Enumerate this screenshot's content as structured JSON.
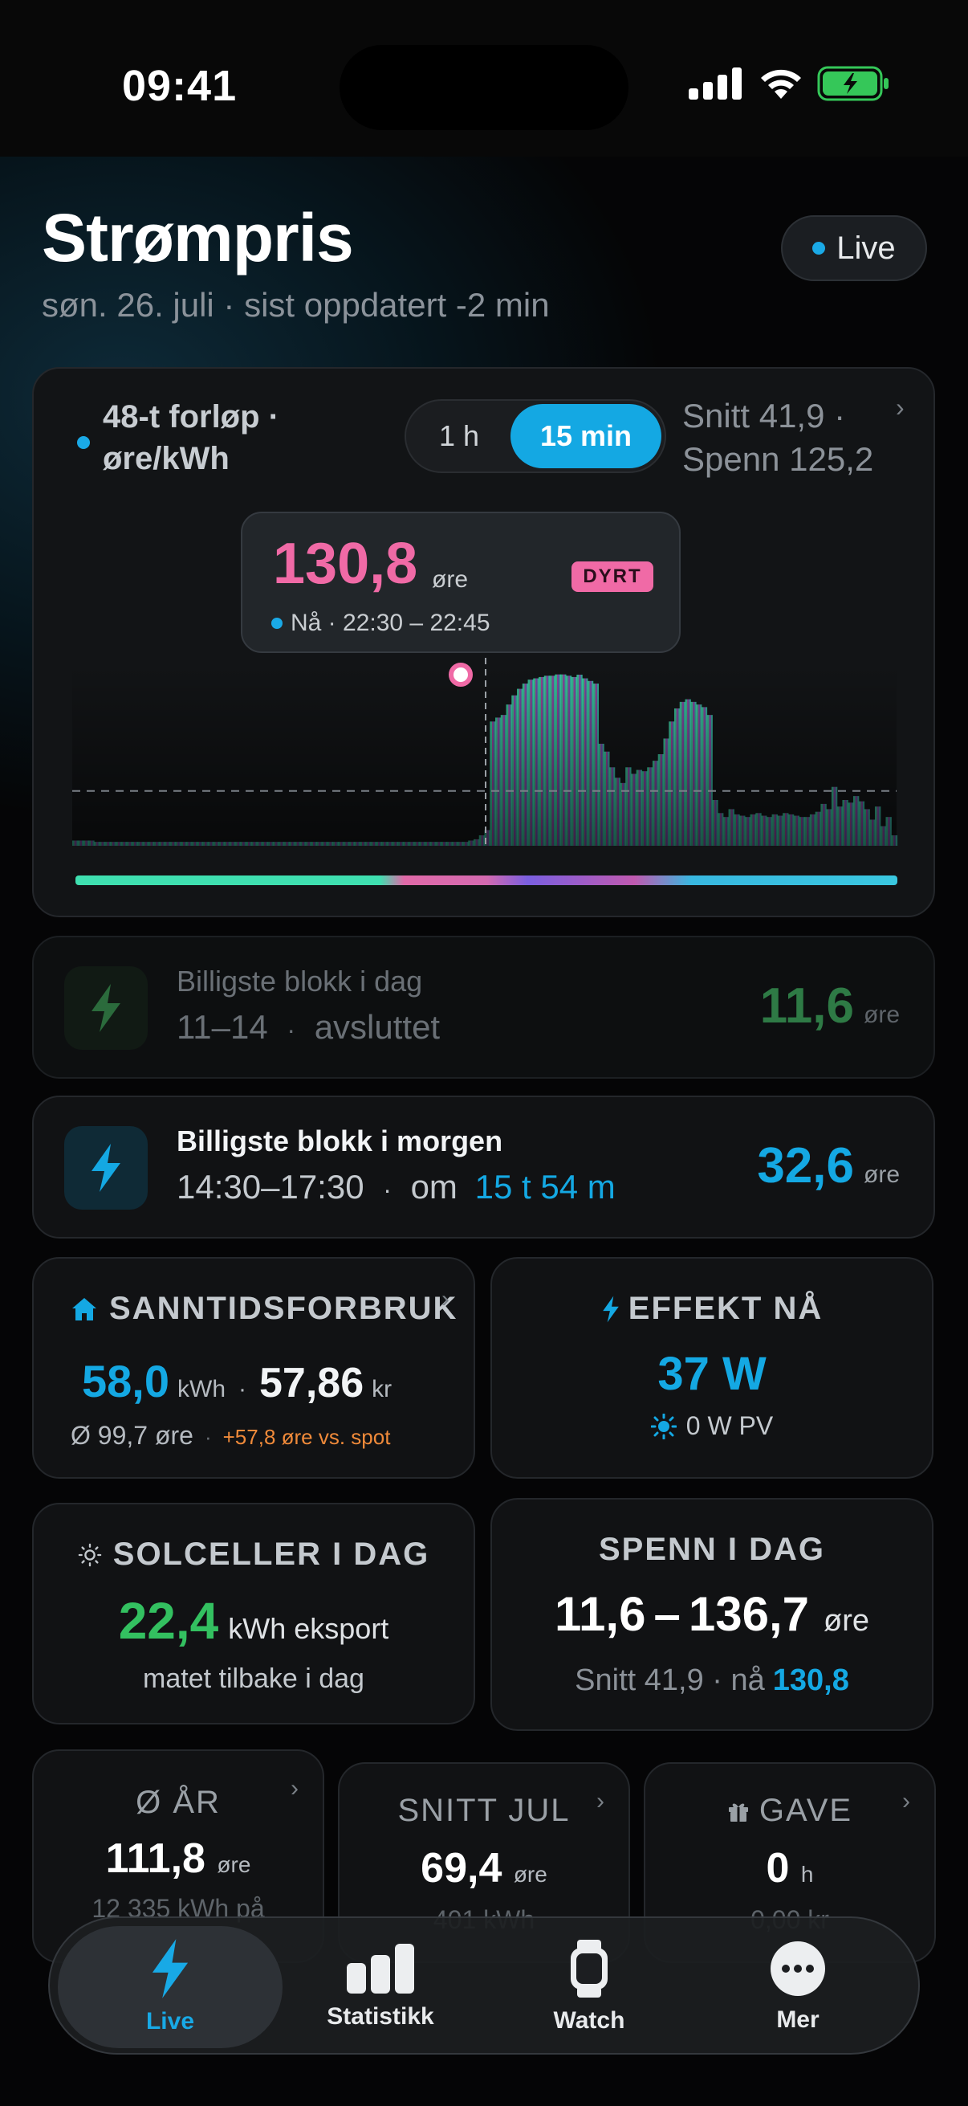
{
  "status_bar": {
    "time": "09:41"
  },
  "header": {
    "title": "Strømpris",
    "subtitle": "søn. 26. juli · sist oppdatert -2 min",
    "live_label": "Live"
  },
  "chart_card": {
    "title_line1": "48-t forløp ·",
    "title_line2": "øre/kWh",
    "segments": [
      "1 h",
      "15 min"
    ],
    "selected_segment": "15 min",
    "stats_line1": "Snitt 41,9 ·",
    "stats_line2": "Spenn 125,2",
    "tooltip": {
      "price": "130,8",
      "unit": "øre",
      "badge": "DYRT",
      "time": "Nå · 22:30 – 22:45"
    }
  },
  "chart_data": {
    "type": "bar",
    "title": "48-t forløp · øre/kWh",
    "ylabel": "øre/kWh",
    "average": 41.9,
    "current": 130.8,
    "ylim": [
      0,
      140
    ],
    "values": [
      4,
      4,
      4,
      4,
      3,
      3,
      3,
      3,
      3,
      3,
      3,
      3,
      3,
      3,
      3,
      3,
      3,
      3,
      3,
      3,
      3,
      3,
      3,
      3,
      3,
      3,
      3,
      3,
      3,
      3,
      3,
      3,
      3,
      3,
      3,
      3,
      3,
      3,
      3,
      3,
      3,
      3,
      3,
      3,
      3,
      3,
      3,
      3,
      3,
      3,
      3,
      3,
      3,
      3,
      3,
      3,
      3,
      3,
      3,
      3,
      3,
      3,
      3,
      3,
      3,
      3,
      3,
      3,
      3,
      3,
      3,
      3,
      3,
      4,
      5,
      8,
      12,
      95,
      98,
      100,
      108,
      115,
      120,
      124,
      127,
      128,
      129,
      130,
      130,
      131,
      131,
      130,
      129,
      130.8,
      128,
      126,
      124,
      78,
      72,
      60,
      52,
      48,
      60,
      55,
      58,
      57,
      60,
      65,
      70,
      82,
      95,
      105,
      110,
      112,
      110,
      108,
      106,
      100,
      35,
      25,
      22,
      28,
      24,
      23,
      22,
      24,
      25,
      23,
      22,
      24,
      23,
      25,
      24,
      23,
      22,
      22,
      24,
      26,
      32,
      28,
      45,
      30,
      35,
      33,
      38,
      34,
      28,
      20,
      30,
      15,
      22,
      8
    ]
  },
  "blocks": [
    {
      "title": "Billigste blokk i dag",
      "time": "11–14",
      "sep": "·",
      "status": "avsluttet",
      "price": "11,6",
      "unit": "øre"
    },
    {
      "title": "Billigste blokk i morgen",
      "time": "14:30–17:30",
      "sep": "·",
      "in_label": "om",
      "countdown": "15 t 54 m",
      "price": "32,6",
      "unit": "øre"
    }
  ],
  "consumption": {
    "header": "SANNTIDSFORBRUK",
    "kwh": "58,0",
    "kwh_unit": "kWh",
    "sep": "·",
    "kr": "57,86",
    "kr_unit": "kr",
    "avg": "Ø 99,7 øre",
    "vs_spot": "+57,8 øre vs. spot"
  },
  "effect": {
    "header": "EFFEKT NÅ",
    "value": "37 W",
    "pv": "0 W PV"
  },
  "solar": {
    "header": "SOLCELLER I DAG",
    "value": "22,4",
    "unit": "kWh eksport",
    "sub": "matet tilbake i dag"
  },
  "range": {
    "header": "SPENN I DAG",
    "min": "11,6",
    "dash": "–",
    "max": "136,7",
    "unit": "øre",
    "avg_label": "Snitt 41,9 · nå",
    "now": "130,8"
  },
  "small_tiles": [
    {
      "header": "Ø ÅR",
      "value": "111,8",
      "unit": "øre",
      "sub": "12 335 kWh på"
    },
    {
      "header": "SNITT JUL",
      "value": "69,4",
      "unit": "øre",
      "sub": "401 kWh"
    },
    {
      "header": "GAVE",
      "value": "0",
      "unit": "h",
      "sub": "0,00 kr"
    }
  ],
  "tabbar": {
    "tabs": [
      "Live",
      "Statistikk",
      "Watch",
      "Mer"
    ],
    "active": "Live"
  },
  "colors": {
    "accent": "#14a8e3",
    "expensive": "#f06aa6",
    "cheap": "#2e8a4c",
    "orange": "#f08a3a",
    "green": "#33c060"
  }
}
